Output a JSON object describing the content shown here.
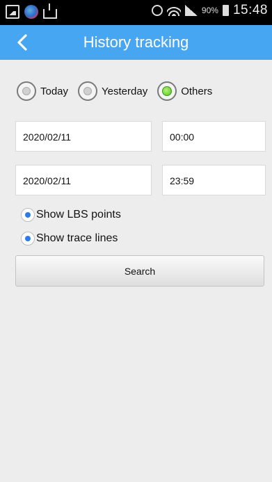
{
  "status_bar": {
    "battery_percent": "90%",
    "time": "15:48",
    "left_icons": [
      "gallery-icon",
      "app-icon",
      "download-icon"
    ],
    "right_icons": [
      "alarm-icon",
      "wifi-icon",
      "signal-icon",
      "battery-icon"
    ]
  },
  "header": {
    "title": "History tracking",
    "back_icon": "chevron-left-icon",
    "bg_color": "#47a6f2"
  },
  "range": {
    "options": [
      {
        "label": "Today",
        "selected": false
      },
      {
        "label": "Yesterday",
        "selected": false
      },
      {
        "label": "Others",
        "selected": true
      }
    ],
    "selected_color": "#52c41a"
  },
  "fields": {
    "start_date": "2020/02/11",
    "start_time": "00:00",
    "end_date": "2020/02/11",
    "end_time": "23:59"
  },
  "options": {
    "show_lbs": "Show LBS points",
    "show_trace": "Show trace lines",
    "accent_color": "#2d7be6"
  },
  "search_button": "Search"
}
